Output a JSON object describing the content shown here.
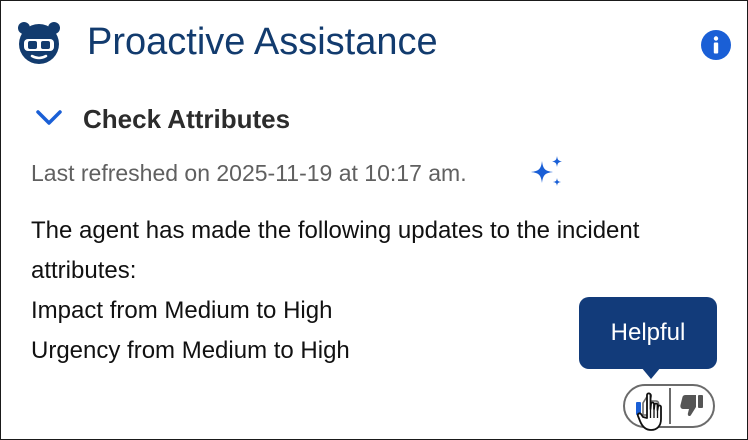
{
  "header": {
    "title": "Proactive Assistance",
    "logo_icon": "assistant-bot-icon",
    "info_icon": "info-icon"
  },
  "section": {
    "title": "Check Attributes",
    "expanded": true,
    "chevron_icon": "chevron-down-icon"
  },
  "refresh": {
    "text": "Last refreshed on 2025-11-19 at 10:17 am.",
    "icon": "sparkle-icon"
  },
  "content": {
    "line1": "The agent has made the following updates to the incident",
    "line2": "attributes:",
    "line3": "Impact from Medium to High",
    "line4": "Urgency from Medium to High"
  },
  "feedback": {
    "tooltip": "Helpful",
    "up_icon": "thumbs-up-icon",
    "down_icon": "thumbs-down-icon",
    "cursor_icon": "hand-pointer-icon"
  },
  "colors": {
    "title": "#123b6e",
    "accent": "#1a5fd6",
    "tooltip_bg": "#123b7a",
    "muted_text": "#606060"
  }
}
